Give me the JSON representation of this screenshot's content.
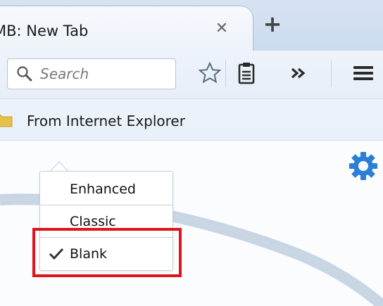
{
  "tab": {
    "title": "MB: New Tab",
    "close_icon": "close-icon",
    "new_tab_icon": "plus-icon"
  },
  "toolbar": {
    "search": {
      "placeholder": "Search"
    },
    "icons": [
      "bookmark-star-icon",
      "reading-list-icon",
      "overflow-chevron-icon",
      "hamburger-menu-icon"
    ]
  },
  "bookmarks": {
    "items": [
      {
        "label": "From Internet Explorer",
        "icon": "folder-icon"
      }
    ]
  },
  "newtab_menu": {
    "items": [
      {
        "label": "Enhanced",
        "checked": false
      },
      {
        "label": "Classic",
        "checked": false
      },
      {
        "label": "Blank",
        "checked": true
      }
    ]
  },
  "colors": {
    "highlight": "#e0141b",
    "gear": "#2b7fd6"
  }
}
